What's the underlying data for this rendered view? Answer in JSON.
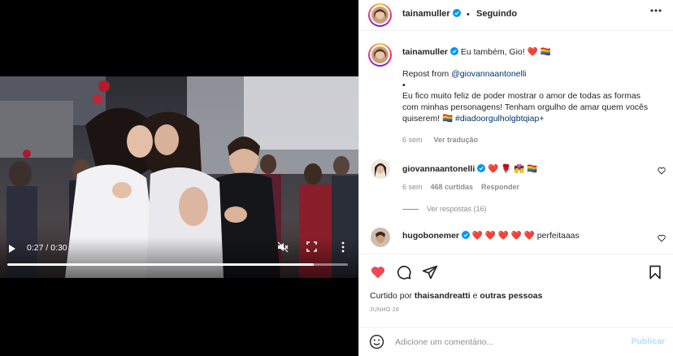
{
  "video": {
    "time": "0:27 / 0:30",
    "progress": 0.9,
    "icons": [
      "play-icon",
      "muted-speaker-icon",
      "fullscreen-icon",
      "more-vertical-icon"
    ]
  },
  "header": {
    "username": "tainamuller",
    "separator": "•",
    "following": "Seguindo",
    "more_icon": "more-horizontal-icon"
  },
  "caption": {
    "username": "tainamuller",
    "first_line": "Eu também, Gio! ❤️ 🏳️‍🌈",
    "repost": "Repost from ",
    "repost_mention": "@giovannaantonelli",
    "bullet": "•",
    "body": "Eu fico muito feliz de poder mostrar o amor de todas as formas com minhas personagens! Tenham orgulho de amar quem vocês quiserem! 🏳️‍🌈 ",
    "hashtag": "#diadoorgulholgbtqiap+",
    "age": "6 sem",
    "translate": "Ver tradução"
  },
  "comments": [
    {
      "username": "giovannaantonelli",
      "text": "❤️ 🌹 💏 🏳️‍🌈",
      "age": "6 sem",
      "likes": "468 curtidas",
      "reply": "Responder",
      "view_replies": "Ver respostas (16)"
    },
    {
      "username": "hugobonemer",
      "text": "❤️ ❤️ ❤️ ❤️ ❤️  perfeitaaas"
    }
  ],
  "actions": {
    "icons": [
      "heart-filled-icon",
      "comment-icon",
      "share-icon",
      "save-icon"
    ],
    "like_color": "#ed4956"
  },
  "likes": {
    "prefix": "Curtido por ",
    "user": "thaisandreatti",
    "middle": " e ",
    "others": "outras pessoas"
  },
  "date": "JUNHO 28",
  "add_comment": {
    "placeholder": "Adicione um comentário...",
    "publish": "Publicar",
    "emoji_icon": "smiley-icon"
  },
  "colors": {
    "verified": "#0095f6",
    "mention": "#00376b",
    "publish_disabled": "#b2dffc",
    "secondary_text": "#8e8e8e"
  }
}
